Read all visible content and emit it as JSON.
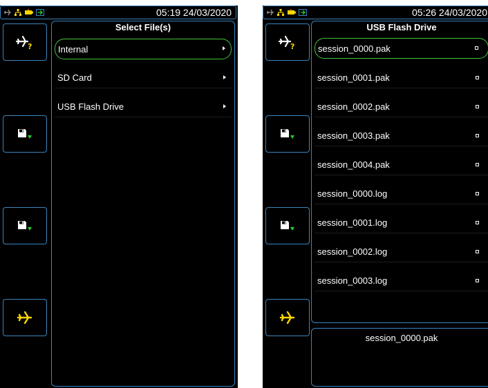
{
  "left": {
    "time": "05:19 24/03/2020",
    "title": "Select File(s)",
    "items": [
      {
        "label": "Internal"
      },
      {
        "label": "SD Card"
      },
      {
        "label": "USB Flash Drive"
      }
    ]
  },
  "right": {
    "time": "05:26 24/03/2020",
    "title": "USB Flash Drive",
    "items": [
      {
        "label": "session_0000.pak"
      },
      {
        "label": "session_0001.pak"
      },
      {
        "label": "session_0002.pak"
      },
      {
        "label": "session_0003.pak"
      },
      {
        "label": "session_0004.pak"
      },
      {
        "label": "session_0000.log"
      },
      {
        "label": "session_0001.log"
      },
      {
        "label": "session_0002.log"
      },
      {
        "label": "session_0003.log"
      }
    ],
    "selected_file": "session_0000.pak"
  },
  "colors": {
    "border": "#3a86c0",
    "selection": "#46c23e",
    "icon_yellow": "#ffd800",
    "icon_green": "#28d028"
  },
  "icons": [
    "plane-question-icon",
    "save-down-icon",
    "plane-icon",
    "network-icon",
    "battery-icon",
    "charging-icon"
  ]
}
